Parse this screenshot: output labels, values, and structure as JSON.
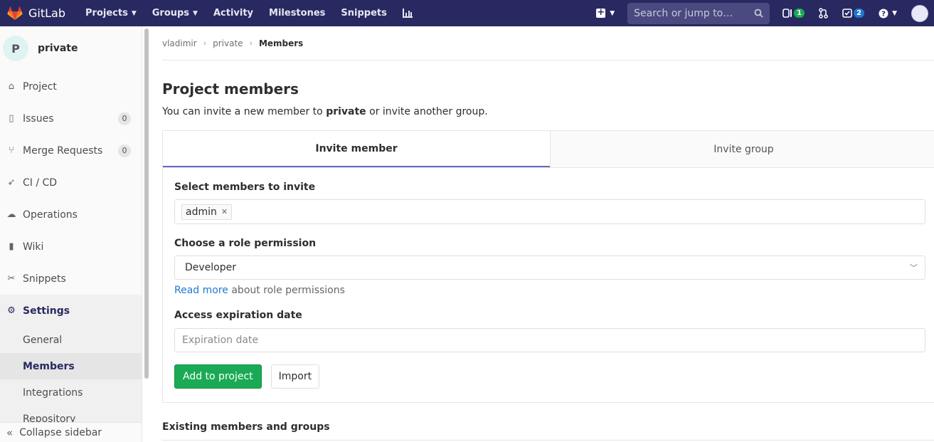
{
  "navbar": {
    "logo_text": "GitLab",
    "links": [
      {
        "label": "Projects",
        "caret": true
      },
      {
        "label": "Groups",
        "caret": true
      },
      {
        "label": "Activity",
        "caret": false
      },
      {
        "label": "Milestones",
        "caret": false
      },
      {
        "label": "Snippets",
        "caret": false
      }
    ],
    "search_placeholder": "Search or jump to…",
    "issues_count": "1",
    "todos_count": "2",
    "brand_color": "#292961"
  },
  "sidebar": {
    "project_initial": "P",
    "project_name": "private",
    "items": [
      {
        "label": "Project",
        "icon": "home-icon"
      },
      {
        "label": "Issues",
        "icon": "issues-icon",
        "count": "0"
      },
      {
        "label": "Merge Requests",
        "icon": "merge-request-icon",
        "count": "0"
      },
      {
        "label": "CI / CD",
        "icon": "rocket-icon"
      },
      {
        "label": "Operations",
        "icon": "cloud-gear-icon"
      },
      {
        "label": "Wiki",
        "icon": "book-icon"
      },
      {
        "label": "Snippets",
        "icon": "scissors-icon"
      },
      {
        "label": "Settings",
        "icon": "settings-icon"
      }
    ],
    "settings_sub": [
      {
        "label": "General"
      },
      {
        "label": "Members"
      },
      {
        "label": "Integrations"
      },
      {
        "label": "Repository"
      }
    ],
    "collapse_label": "Collapse sidebar"
  },
  "breadcrumb": {
    "items": [
      "vladimir",
      "private"
    ],
    "current": "Members"
  },
  "main": {
    "title": "Project members",
    "intro_before": "You can invite a new member to ",
    "intro_project": "private",
    "intro_after": " or invite another group.",
    "tabs": [
      {
        "label": "Invite member"
      },
      {
        "label": "Invite group"
      }
    ],
    "form": {
      "select_label": "Select members to invite",
      "selected_token": "admin",
      "role_label": "Choose a role permission",
      "role_value": "Developer",
      "help_link": "Read more",
      "help_text": " about role permissions",
      "expiry_label": "Access expiration date",
      "expiry_placeholder": "Expiration date",
      "add_button": "Add to project",
      "import_button": "Import"
    },
    "existing_heading": "Existing members and groups"
  }
}
